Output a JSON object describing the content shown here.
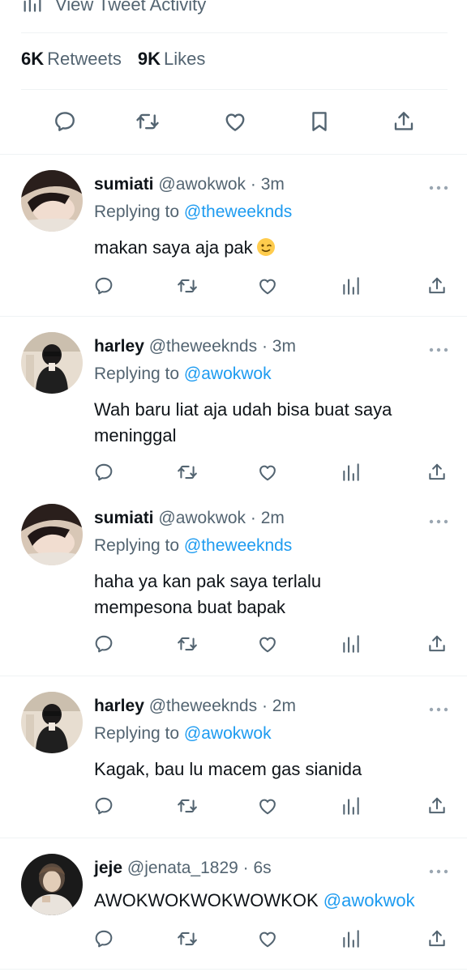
{
  "tweet": {
    "activity_label": "View Tweet Activity",
    "retweets_count": "6K",
    "retweets_label": "Retweets",
    "likes_count": "9K",
    "likes_label": "Likes"
  },
  "replies": [
    {
      "name": "sumiati",
      "meta": "@awokwok · 3m",
      "replying_prefix": "Replying to",
      "replying_to": "@theweeknds",
      "text": "makan saya aja pak",
      "emoji": "winking-face"
    },
    {
      "name": "harley",
      "meta": "@theweeknds · 3m",
      "replying_prefix": "Replying to",
      "replying_to": "@awokwok",
      "text_lines": [
        "Wah baru liat aja udah bisa buat saya",
        "meninggal"
      ]
    },
    {
      "name": "sumiati",
      "meta": "@awokwok · 2m",
      "replying_prefix": "Replying to",
      "replying_to": "@theweeknds",
      "text_lines": [
        "haha ya kan pak saya terlalu",
        "mempesona buat bapak"
      ]
    },
    {
      "name": "harley",
      "meta": "@theweeknds · 2m",
      "replying_prefix": "Replying to",
      "replying_to": "@awokwok",
      "text": "Kagak, bau lu macem gas sianida"
    },
    {
      "name": "jeje",
      "meta": "@jenata_1829 · 6s",
      "text": "AWOKWOKWOKWOWKOK",
      "mention": "@awokwok"
    }
  ],
  "colors": {
    "text": "#0f1419",
    "secondary": "#536471",
    "link": "#1d9bf0",
    "divider": "#eff3f4"
  },
  "icons": [
    "bar-chart-icon",
    "reply-icon",
    "retweet-icon",
    "like-icon",
    "bookmark-icon",
    "share-icon",
    "more-icon",
    "analytics-icon"
  ]
}
